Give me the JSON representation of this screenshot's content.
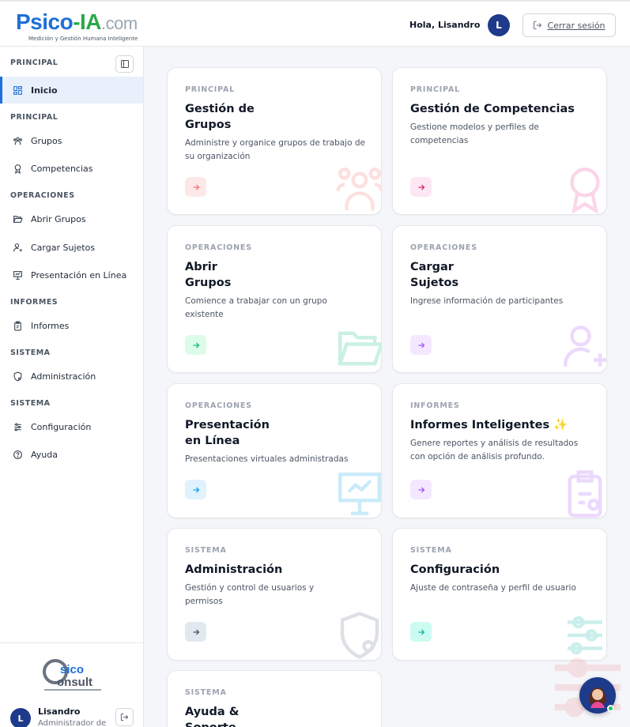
{
  "header": {
    "logo_part1": "Psico",
    "logo_part2": "-IA",
    "logo_part3": ".com",
    "logo_tagline": "Medición y Gestión Humana Inteligente",
    "greeting": "Hola, Lisandro",
    "avatar_initial": "L",
    "logout_label": "Cerrar sesión"
  },
  "sidebar": {
    "top_section": "PRINCIPAL",
    "items": [
      {
        "section": "",
        "label": "Inicio",
        "icon": "grid-icon"
      },
      {
        "section": "PRINCIPAL",
        "label": "Grupos",
        "icon": "users-icon"
      },
      {
        "section": "",
        "label": "Competencias",
        "icon": "award-icon"
      },
      {
        "section": "OPERACIONES",
        "label": "Abrir Grupos",
        "icon": "folder-open-icon"
      },
      {
        "section": "",
        "label": "Cargar Sujetos",
        "icon": "user-plus-icon"
      },
      {
        "section": "",
        "label": "Presentación en Línea",
        "icon": "presentation-icon"
      },
      {
        "section": "INFORMES",
        "label": "Informes",
        "icon": "clipboard-icon"
      },
      {
        "section": "SISTEMA",
        "label": "Administración",
        "icon": "shield-icon"
      },
      {
        "section": "SISTEMA",
        "label": "Configuración",
        "icon": "sliders-icon"
      },
      {
        "section": "",
        "label": "Ayuda",
        "icon": "help-icon"
      }
    ],
    "sections": [
      "PRINCIPAL",
      "OPERACIONES",
      "INFORMES",
      "SISTEMA",
      "SISTEMA"
    ],
    "user": {
      "initial": "L",
      "name": "Lisandro",
      "role": "Administrador de E"
    },
    "brand_logo_text": "Psico Consult"
  },
  "cards": [
    {
      "category": "PRINCIPAL",
      "title": "Gestión de Grupos",
      "description": "Administre y organice grupos de trabajo de su organización",
      "accent": "#f87171",
      "accent_bg": "#fde8e8",
      "icon": "users-icon"
    },
    {
      "category": "PRINCIPAL",
      "title": "Gestión de Competencias",
      "description": "Gestione modelos y perfiles de competencias",
      "accent": "#db2777",
      "accent_bg": "#fce7f3",
      "icon": "award-icon"
    },
    {
      "category": "OPERACIONES",
      "title": "Abrir Grupos",
      "description": "Comience a trabajar con un grupo existente",
      "accent": "#10b981",
      "accent_bg": "#dcfce7",
      "icon": "folder-open-icon"
    },
    {
      "category": "OPERACIONES",
      "title": "Cargar Sujetos",
      "description": "Ingrese información de participantes",
      "accent": "#a855f7",
      "accent_bg": "#f3e8ff",
      "icon": "user-plus-icon"
    },
    {
      "category": "OPERACIONES",
      "title": "Presentación en Línea",
      "description": "Presentaciones virtuales administradas",
      "accent": "#0ea5e9",
      "accent_bg": "#e0f2fe",
      "icon": "presentation-icon"
    },
    {
      "category": "INFORMES",
      "title": "Informes Inteligentes ✨",
      "description": "Genere reportes y análisis de resultados con opción de análisis profundo.",
      "accent": "#a855f7",
      "accent_bg": "#f3e8ff",
      "icon": "clipboard-icon"
    },
    {
      "category": "SISTEMA",
      "title": "Administración",
      "description": "Gestión y control de usuarios y permisos",
      "accent": "#475569",
      "accent_bg": "#e2e8f0",
      "icon": "shield-icon"
    },
    {
      "category": "SISTEMA",
      "title": "Configuración",
      "description": "Ajuste de contraseña y perfil de usuario",
      "accent": "#14b8a6",
      "accent_bg": "#ccfbf1",
      "icon": "sliders-icon"
    },
    {
      "category": "SISTEMA",
      "title": "Ayuda & Soporte",
      "description": "",
      "accent": "#6b7280",
      "accent_bg": "#f3f4f6",
      "icon": "help-icon"
    }
  ],
  "chat_button_icon": "assistant-avatar-icon"
}
